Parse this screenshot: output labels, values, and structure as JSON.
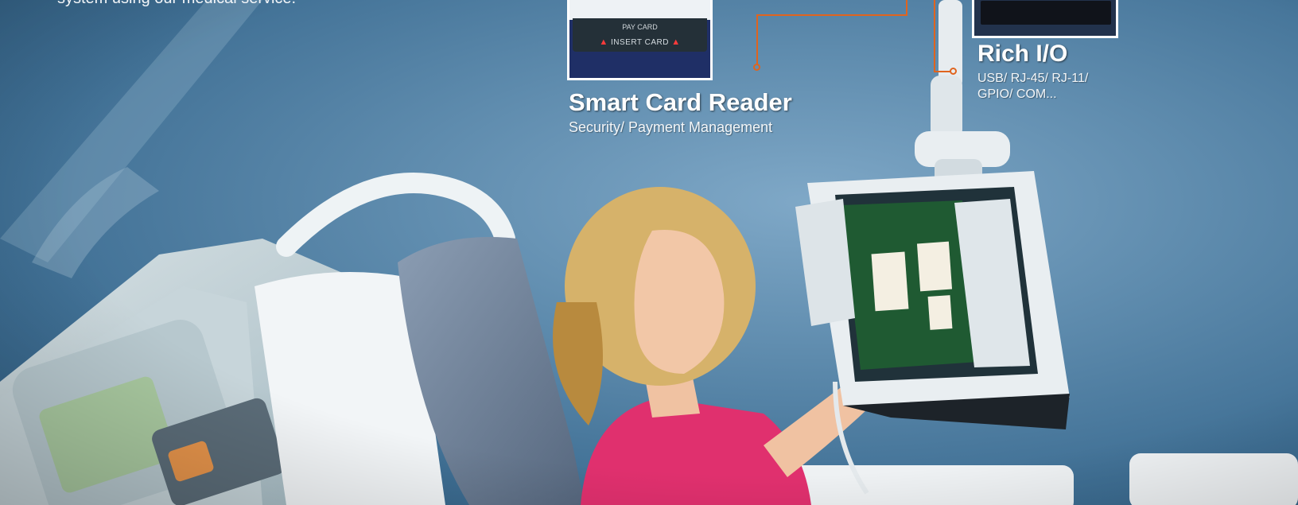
{
  "intro": {
    "text": "system using our medical service."
  },
  "callouts": {
    "smart_card": {
      "title": "Smart Card Reader",
      "subtitle": "Security/ Payment Management",
      "thumb_pay": "PAY CARD",
      "thumb_insert": "INSERT CARD"
    },
    "rich_io": {
      "title": "Rich I/O",
      "subtitle_line1": "USB/ RJ-45/ RJ-11/",
      "subtitle_line2": "GPIO/ COM..."
    }
  },
  "colors": {
    "background": "#5f8cae",
    "connector": "#e0641e",
    "text": "#ffffff"
  }
}
